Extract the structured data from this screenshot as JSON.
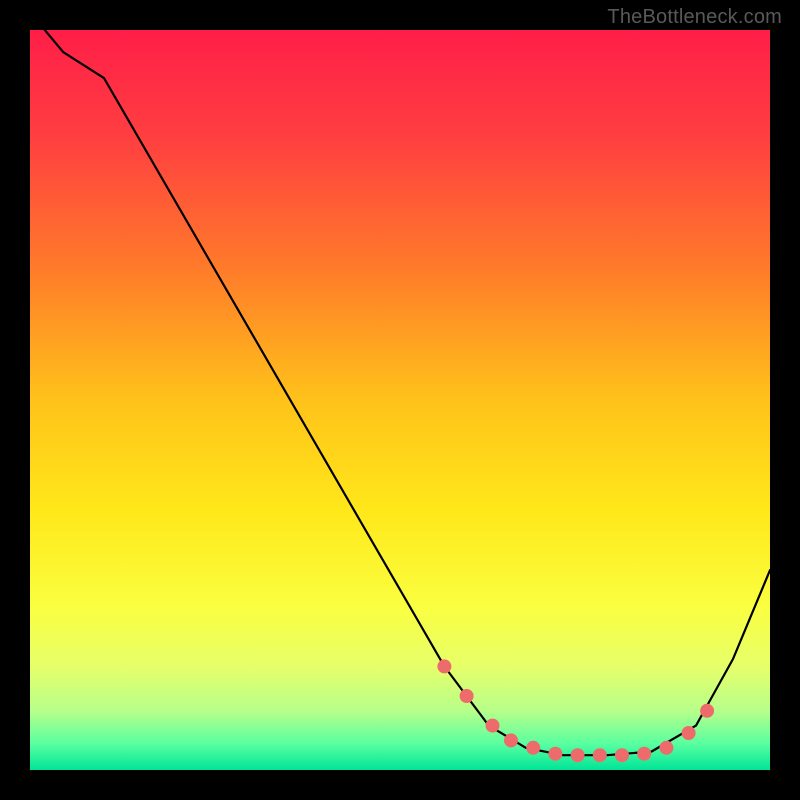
{
  "watermark": "TheBottleneck.com",
  "chart_data": {
    "type": "line",
    "title": "",
    "xlabel": "",
    "ylabel": "",
    "xlim": [
      0,
      100
    ],
    "ylim": [
      0,
      100
    ],
    "grid": false,
    "legend": false,
    "background_gradient_stops": [
      {
        "offset": 0.0,
        "color": "#ff1e48"
      },
      {
        "offset": 0.15,
        "color": "#ff4040"
      },
      {
        "offset": 0.32,
        "color": "#ff7a2a"
      },
      {
        "offset": 0.5,
        "color": "#ffc21a"
      },
      {
        "offset": 0.65,
        "color": "#ffe81a"
      },
      {
        "offset": 0.78,
        "color": "#faff40"
      },
      {
        "offset": 0.86,
        "color": "#e6ff6a"
      },
      {
        "offset": 0.92,
        "color": "#b7ff8a"
      },
      {
        "offset": 0.965,
        "color": "#58ffa0"
      },
      {
        "offset": 1.0,
        "color": "#00e597"
      }
    ],
    "series": [
      {
        "name": "curve",
        "stroke": "#000000",
        "stroke_width": 2.2,
        "x": [
          2.0,
          4.5,
          10.0,
          56.0,
          62.0,
          67.0,
          72.0,
          78.0,
          84.0,
          90.0,
          95.0,
          100.0
        ],
        "y": [
          100.0,
          97.0,
          93.5,
          14.0,
          6.0,
          3.0,
          2.0,
          2.0,
          2.5,
          6.0,
          15.0,
          27.0
        ],
        "note": "y is percent of plot height from bottom; curve descends from top-left, flattens near x≈70-85, then rises toward right edge"
      },
      {
        "name": "markers",
        "stroke": "none",
        "fill": "#ee6b6b",
        "marker_radius": 7,
        "x": [
          56.0,
          59.0,
          62.5,
          65.0,
          68.0,
          71.0,
          74.0,
          77.0,
          80.0,
          83.0,
          86.0,
          89.0,
          91.5
        ],
        "y": [
          14.0,
          10.0,
          6.0,
          4.0,
          3.0,
          2.2,
          2.0,
          2.0,
          2.0,
          2.2,
          3.0,
          5.0,
          8.0
        ],
        "note": "salmon dots clustered along the valley of the curve"
      }
    ]
  }
}
